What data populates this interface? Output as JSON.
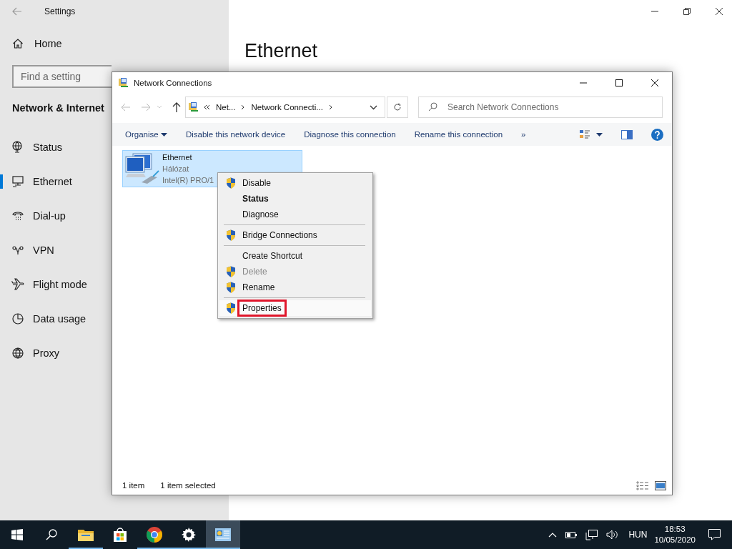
{
  "settings": {
    "title": "Settings",
    "home": "Home",
    "search": {
      "placeholder": "Find a setting"
    },
    "section": "Network & Internet",
    "nav": [
      {
        "label": "Status",
        "selected": false
      },
      {
        "label": "Ethernet",
        "selected": true
      },
      {
        "label": "Dial-up",
        "selected": false
      },
      {
        "label": "VPN",
        "selected": false
      },
      {
        "label": "Flight mode",
        "selected": false
      },
      {
        "label": "Data usage",
        "selected": false
      },
      {
        "label": "Proxy",
        "selected": false
      }
    ],
    "page_title": "Ethernet"
  },
  "explorer": {
    "title": "Network Connections",
    "address": [
      "Net...",
      "Network Connecti..."
    ],
    "search": {
      "placeholder": "Search Network Connections"
    },
    "commands": [
      "Organise",
      "Disable this network device",
      "Diagnose this connection",
      "Rename this connection",
      "»"
    ],
    "items": [
      {
        "name": "Ethernet",
        "network": "Hálózat",
        "adapter": "Intel(R) PRO/1",
        "selected": true
      }
    ],
    "status_bar": [
      "1 item",
      "1 item selected"
    ]
  },
  "context_menu": [
    {
      "kind": "item",
      "label": "Disable",
      "shield": true,
      "bold": false,
      "disabled": false,
      "selected": false
    },
    {
      "kind": "item",
      "label": "Status",
      "shield": false,
      "bold": true,
      "disabled": false,
      "selected": false
    },
    {
      "kind": "item",
      "label": "Diagnose",
      "shield": false,
      "bold": false,
      "disabled": false,
      "selected": false
    },
    {
      "kind": "separator"
    },
    {
      "kind": "item",
      "label": "Bridge Connections",
      "shield": true,
      "bold": false,
      "disabled": false,
      "selected": false
    },
    {
      "kind": "separator"
    },
    {
      "kind": "item",
      "label": "Create Shortcut",
      "shield": false,
      "bold": false,
      "disabled": false,
      "selected": false
    },
    {
      "kind": "item",
      "label": "Delete",
      "shield": true,
      "bold": false,
      "disabled": true,
      "selected": false
    },
    {
      "kind": "item",
      "label": "Rename",
      "shield": true,
      "bold": false,
      "disabled": false,
      "selected": false
    },
    {
      "kind": "separator"
    },
    {
      "kind": "item",
      "label": "Properties",
      "shield": true,
      "bold": false,
      "disabled": false,
      "selected": true
    }
  ],
  "taskbar": {
    "apps": [
      {
        "kind": "explorer",
        "running": true,
        "selected": false
      },
      {
        "kind": "store",
        "running": false,
        "selected": false
      },
      {
        "kind": "chrome",
        "running": true,
        "selected": false
      },
      {
        "kind": "settings",
        "running": true,
        "selected": false
      },
      {
        "kind": "network",
        "running": true,
        "selected": true
      }
    ],
    "language": "HUN",
    "time": "18:53",
    "date": "10/05/2020"
  }
}
